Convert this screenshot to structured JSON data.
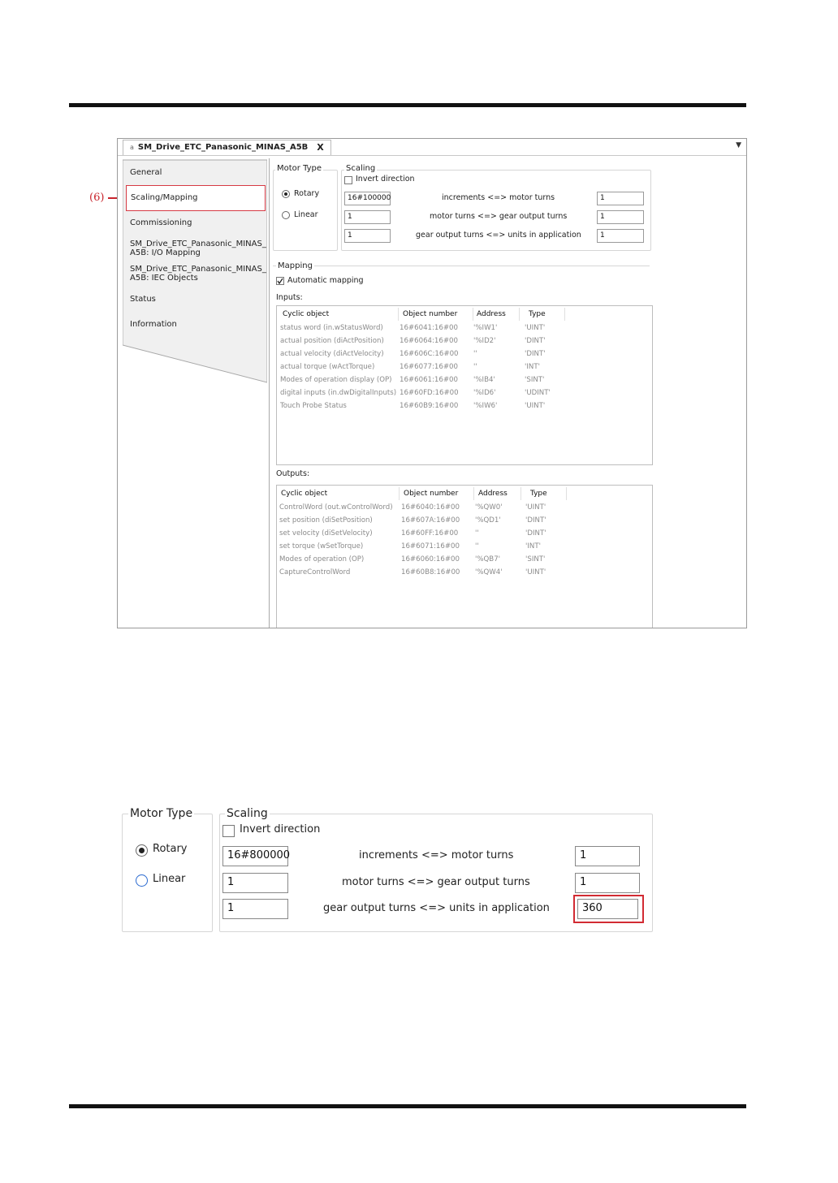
{
  "annotation": {
    "marker": "(6)"
  },
  "window": {
    "tab_title": "SM_Drive_ETC_Panasonic_MINAS_A5B",
    "tab_close": "X",
    "tab_pin": "a",
    "dropdown": "▼"
  },
  "sidebar": {
    "items": [
      {
        "label": "General"
      },
      {
        "label": "Scaling/Mapping"
      },
      {
        "label": "Commissioning"
      },
      {
        "label": "SM_Drive_ETC_Panasonic_MINAS_",
        "label2": "A5B: I/O Mapping"
      },
      {
        "label": "SM_Drive_ETC_Panasonic_MINAS_",
        "label2": "A5B: IEC Objects"
      },
      {
        "label": "Status"
      },
      {
        "label": "Information"
      }
    ]
  },
  "motor_type": {
    "title": "Motor Type",
    "rotary": "Rotary",
    "linear": "Linear",
    "selected": "Rotary"
  },
  "scaling": {
    "title": "Scaling",
    "invert_direction": "Invert direction",
    "rows": [
      {
        "left": "16#100000",
        "label": "increments <=> motor turns",
        "right": "1"
      },
      {
        "left": "1",
        "label": "motor turns <=> gear output turns",
        "right": "1"
      },
      {
        "left": "1",
        "label": "gear output turns <=> units in application",
        "right": "1"
      }
    ]
  },
  "mapping": {
    "title": "Mapping",
    "automatic": "Automatic mapping",
    "inputs_label": "Inputs:",
    "outputs_label": "Outputs:",
    "columns": [
      "Cyclic object",
      "Object number",
      "Address",
      "Type"
    ],
    "inputs": [
      [
        "status word (in.wStatusWord)",
        "16#6041:16#00",
        "'%IW1'",
        "'UINT'"
      ],
      [
        "actual position (diActPosition)",
        "16#6064:16#00",
        "'%ID2'",
        "'DINT'"
      ],
      [
        "actual velocity (diActVelocity)",
        "16#606C:16#00",
        "''",
        "'DINT'"
      ],
      [
        "actual torque (wActTorque)",
        "16#6077:16#00",
        "''",
        "'INT'"
      ],
      [
        "Modes of operation display (OP)",
        "16#6061:16#00",
        "'%IB4'",
        "'SINT'"
      ],
      [
        "digital inputs (in.dwDigitalInputs)",
        "16#60FD:16#00",
        "'%ID6'",
        "'UDINT'"
      ],
      [
        "Touch Probe Status",
        "16#60B9:16#00",
        "'%IW6'",
        "'UINT'"
      ]
    ],
    "outputs": [
      [
        "ControlWord (out.wControlWord)",
        "16#6040:16#00",
        "'%QW0'",
        "'UINT'"
      ],
      [
        "set position (diSetPosition)",
        "16#607A:16#00",
        "'%QD1'",
        "'DINT'"
      ],
      [
        "set velocity (diSetVelocity)",
        "16#60FF:16#00",
        "''",
        "'DINT'"
      ],
      [
        "set torque (wSetTorque)",
        "16#6071:16#00",
        "''",
        "'INT'"
      ],
      [
        "Modes of operation (OP)",
        "16#6060:16#00",
        "'%QB7'",
        "'SINT'"
      ],
      [
        "CaptureControlWord",
        "16#60B8:16#00",
        "'%QW4'",
        "'UINT'"
      ]
    ]
  },
  "zoom": {
    "motor_type_title": "Motor Type",
    "rotary": "Rotary",
    "linear": "Linear",
    "scaling_title": "Scaling",
    "invert_direction": "Invert direction",
    "rows": [
      {
        "left": "16#800000",
        "label": "increments <=> motor turns",
        "right": "1"
      },
      {
        "left": "1",
        "label": "motor turns <=> gear output turns",
        "right": "1"
      },
      {
        "left": "1",
        "label": "gear output turns <=> units in application",
        "right": "360"
      }
    ]
  },
  "colors": {
    "highlight": "#d22b33",
    "rule": "#111111"
  }
}
